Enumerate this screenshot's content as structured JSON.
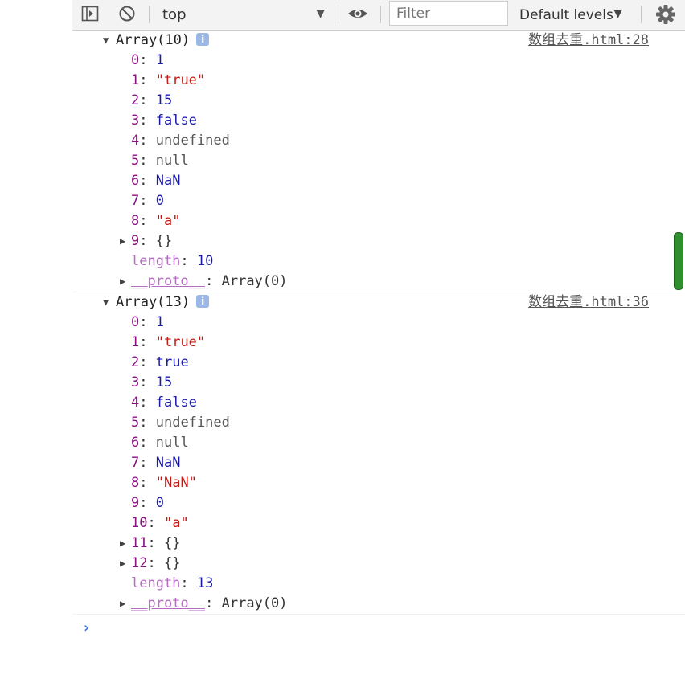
{
  "toolbar": {
    "context": "top",
    "filter_placeholder": "Filter",
    "levels": "Default levels"
  },
  "messages": [
    {
      "summary": "Array(10)",
      "source": "数组去重.html:28",
      "entries": [
        {
          "key": "0",
          "value": "1",
          "kind": "num",
          "expandable": false
        },
        {
          "key": "1",
          "value": "\"true\"",
          "kind": "str",
          "expandable": false
        },
        {
          "key": "2",
          "value": "15",
          "kind": "num",
          "expandable": false
        },
        {
          "key": "3",
          "value": "false",
          "kind": "num",
          "expandable": false
        },
        {
          "key": "4",
          "value": "undefined",
          "kind": "grey",
          "expandable": false
        },
        {
          "key": "5",
          "value": "null",
          "kind": "grey",
          "expandable": false
        },
        {
          "key": "6",
          "value": "NaN",
          "kind": "num",
          "expandable": false
        },
        {
          "key": "7",
          "value": "0",
          "kind": "num",
          "expandable": false
        },
        {
          "key": "8",
          "value": "\"a\"",
          "kind": "str",
          "expandable": false
        },
        {
          "key": "9",
          "value": "{}",
          "kind": "plain",
          "expandable": true
        }
      ],
      "length_label": "length",
      "length_value": "10",
      "proto_label": "__proto__",
      "proto_value": "Array(0)"
    },
    {
      "summary": "Array(13)",
      "source": "数组去重.html:36",
      "entries": [
        {
          "key": "0",
          "value": "1",
          "kind": "num",
          "expandable": false
        },
        {
          "key": "1",
          "value": "\"true\"",
          "kind": "str",
          "expandable": false
        },
        {
          "key": "2",
          "value": "true",
          "kind": "num",
          "expandable": false
        },
        {
          "key": "3",
          "value": "15",
          "kind": "num",
          "expandable": false
        },
        {
          "key": "4",
          "value": "false",
          "kind": "num",
          "expandable": false
        },
        {
          "key": "5",
          "value": "undefined",
          "kind": "grey",
          "expandable": false
        },
        {
          "key": "6",
          "value": "null",
          "kind": "grey",
          "expandable": false
        },
        {
          "key": "7",
          "value": "NaN",
          "kind": "num",
          "expandable": false
        },
        {
          "key": "8",
          "value": "\"NaN\"",
          "kind": "str",
          "expandable": false
        },
        {
          "key": "9",
          "value": "0",
          "kind": "num",
          "expandable": false
        },
        {
          "key": "10",
          "value": "\"a\"",
          "kind": "str",
          "expandable": false
        },
        {
          "key": "11",
          "value": "{}",
          "kind": "plain",
          "expandable": true
        },
        {
          "key": "12",
          "value": "{}",
          "kind": "plain",
          "expandable": true
        }
      ],
      "length_label": "length",
      "length_value": "13",
      "proto_label": "__proto__",
      "proto_value": "Array(0)"
    }
  ],
  "prompt": "›",
  "colors": {
    "key": "#881280",
    "number": "#1a1aa6",
    "string": "#c41a16",
    "link_prompt": "#3a6fe0",
    "scroll_thumb": "#2f8f2f"
  },
  "icons": [
    "sidebar-toggle-icon",
    "clear-console-icon",
    "eye-icon",
    "gear-icon",
    "info-icon"
  ]
}
